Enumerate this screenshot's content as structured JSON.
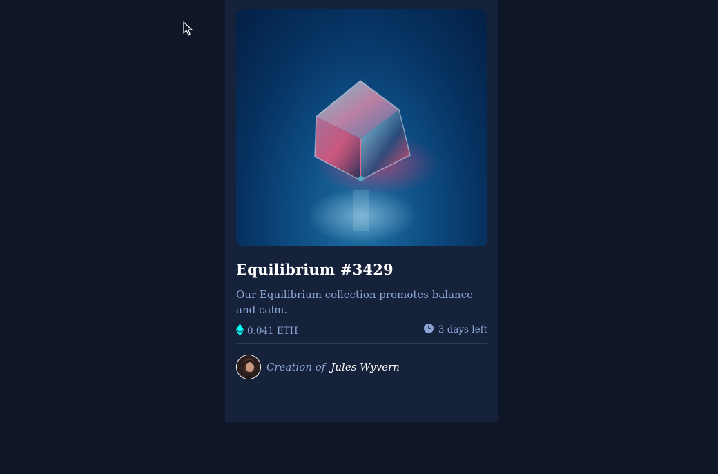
{
  "card": {
    "title": "Equilibrium #3429",
    "description": "Our Equilibrium collection promotes balance and calm.",
    "price": "0.041 ETH",
    "time_left": "3 days left",
    "creator_prefix": "Creation of",
    "creator_name": "Jules Wyvern"
  },
  "icons": {
    "price": "ethereum-icon",
    "time": "clock-icon",
    "cursor": "mouse-cursor"
  },
  "colors": {
    "page_bg": "#0e1628",
    "card_bg": "#16213a",
    "accent_cyan": "#00fff8",
    "muted_text": "#8ba6d4",
    "heading_text": "#ffffff",
    "divider": "#2b3a58"
  }
}
